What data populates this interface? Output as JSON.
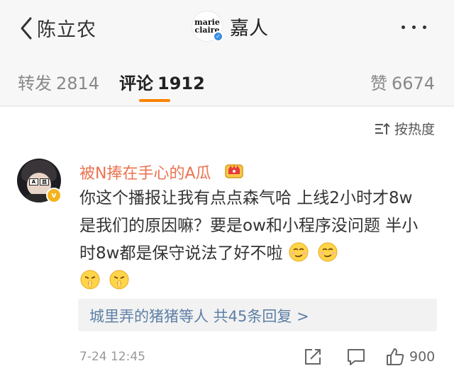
{
  "nav": {
    "back_label": "陈立农",
    "brand_line1": "marie",
    "brand_line2": "claire",
    "title": "嘉人",
    "icons": {
      "back": "chevron-left-icon",
      "more": "more-dots-icon",
      "verified": "verified-badge-icon"
    }
  },
  "tabs": [
    {
      "label": "转发",
      "count": "2814",
      "active": false
    },
    {
      "label": "评论",
      "count": "1912",
      "active": true
    },
    {
      "label": "赞",
      "count": "6674",
      "active": false
    }
  ],
  "sort": {
    "label": "按热度",
    "icon": "sort-icon"
  },
  "comment": {
    "username": "被N捧在手心的A瓜",
    "badge": "crown-badge-icon",
    "avatar_tag_left": "A",
    "avatar_tag_right": "皿",
    "verified_mark": "v",
    "text": "你这个播报让我有点点森气哈 上线2小时才8w 是我们的原因嘛？要是ow和小程序没问题 半小时8w都是保守说法了好不啦",
    "emojis": [
      "smug-emoji",
      "smug-emoji",
      "shush-emoji",
      "shush-emoji"
    ],
    "replies_summary": "城里弄的猪猪等人 共45条回复 >",
    "timestamp": "7-24 12:45",
    "like_count": "900",
    "action_icons": [
      "share-icon",
      "comment-icon",
      "thumbs-up-icon"
    ]
  },
  "colors": {
    "accent": "#ff8200",
    "username": "#eb7350",
    "link": "#5d7fa6",
    "verified_gold": "#f5b31e",
    "verified_blue": "#3a8fe3"
  }
}
